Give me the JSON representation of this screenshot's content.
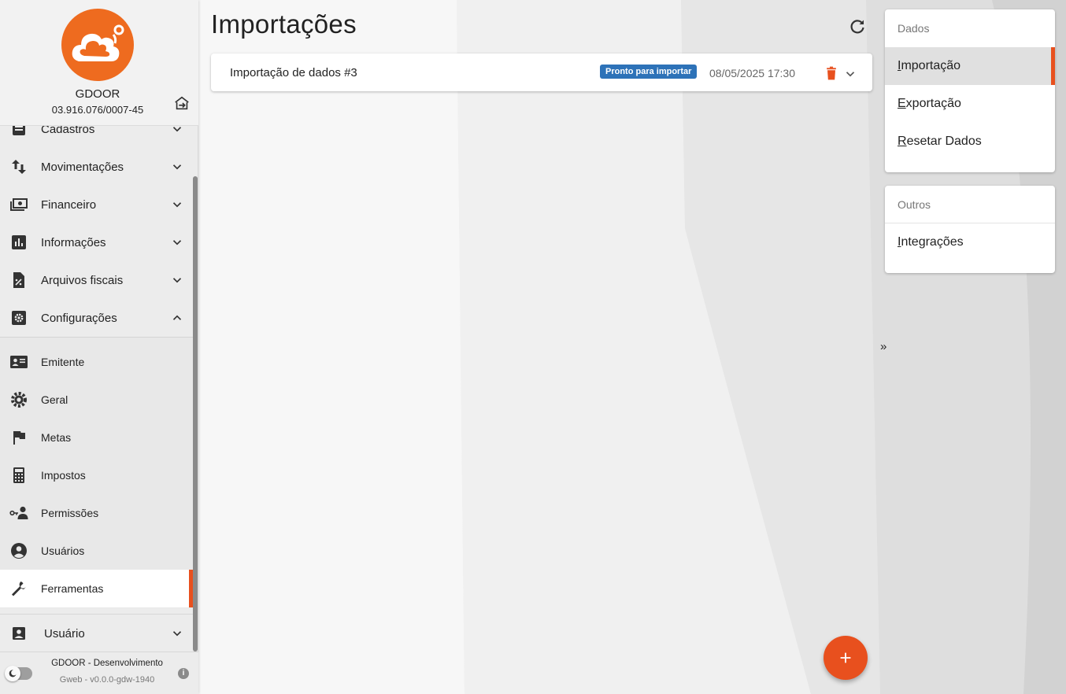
{
  "company": {
    "name": "GDOOR",
    "cnpj": "03.916.076/0007-45"
  },
  "nav": {
    "items": [
      {
        "label": "Cadastros",
        "icon": "list-icon"
      },
      {
        "label": "Movimentações",
        "icon": "swap-vertical-icon"
      },
      {
        "label": "Financeiro",
        "icon": "money-icon"
      },
      {
        "label": "Informações",
        "icon": "bar-chart-icon"
      },
      {
        "label": "Arquivos fiscais",
        "icon": "file-percent-icon"
      },
      {
        "label": "Configurações",
        "icon": "settings-box-icon"
      }
    ],
    "sub_items": [
      {
        "label": "Emitente",
        "icon": "id-card-icon"
      },
      {
        "label": "Geral",
        "icon": "gear-icon"
      },
      {
        "label": "Metas",
        "icon": "flag-icon"
      },
      {
        "label": "Impostos",
        "icon": "calculator-icon"
      },
      {
        "label": "Permissões",
        "icon": "user-key-icon"
      },
      {
        "label": "Usuários",
        "icon": "account-circle-icon"
      },
      {
        "label": "Ferramentas",
        "icon": "wrench-icon"
      }
    ],
    "user": {
      "label": "Usuário",
      "icon": "account-box-icon"
    }
  },
  "footer": {
    "env": "GDOOR - Desenvolvimento",
    "version": "Gweb - v0.0.0-gdw-1940"
  },
  "main": {
    "title": "Importações",
    "card": {
      "title": "Importação de dados #3",
      "status": "Pronto para importar",
      "date": "08/05/2025 17:30"
    },
    "collapse_label": "»"
  },
  "right_panel": {
    "dados": {
      "header": "Dados",
      "items": [
        {
          "first": "I",
          "rest": "mportação"
        },
        {
          "first": "E",
          "rest": "xportação"
        },
        {
          "first": "R",
          "rest": "esetar Dados"
        }
      ]
    },
    "outros": {
      "header": "Outros",
      "items": [
        {
          "first": "I",
          "rest": "ntegrações"
        }
      ]
    }
  },
  "colors": {
    "accent": "#e8501e",
    "logo": "#ee6b1f",
    "badge": "#2d72b8"
  }
}
